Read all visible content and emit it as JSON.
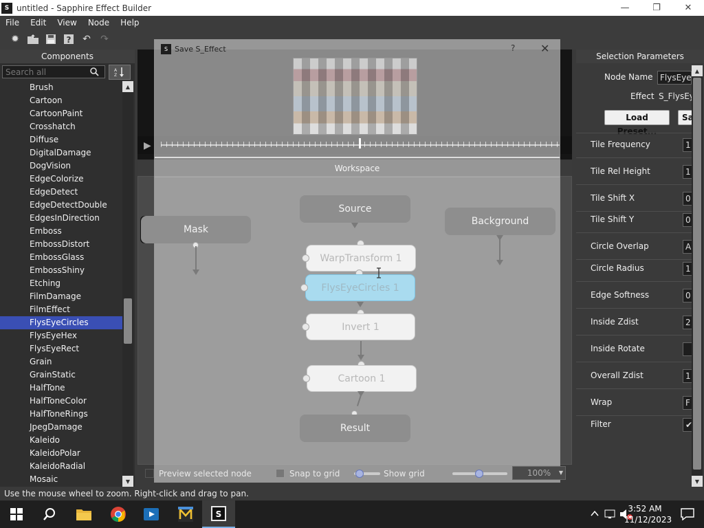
{
  "window": {
    "title": "untitled - Sapphire Effect Builder",
    "app_icon": "S",
    "minimize_icon": "—",
    "maximize_icon": "❐",
    "close_icon": "✕"
  },
  "menu": [
    "File",
    "Edit",
    "View",
    "Node",
    "Help"
  ],
  "left_panel": {
    "header": "Components",
    "search_placeholder": "Search all",
    "selected": "FlysEyeCircles",
    "items": [
      "Brush",
      "Cartoon",
      "CartoonPaint",
      "Crosshatch",
      "Diffuse",
      "DigitalDamage",
      "DogVision",
      "EdgeColorize",
      "EdgeDetect",
      "EdgeDetectDouble",
      "EdgesInDirection",
      "Emboss",
      "EmbossDistort",
      "EmbossGlass",
      "EmbossShiny",
      "Etching",
      "FilmDamage",
      "FilmEffect",
      "FlysEyeCircles",
      "FlysEyeHex",
      "FlysEyeRect",
      "Grain",
      "GrainStatic",
      "HalfTone",
      "HalfToneColor",
      "HalfToneRings",
      "JpegDamage",
      "Kaleido",
      "KaleidoPolar",
      "KaleidoRadial",
      "Mosaic"
    ]
  },
  "right_panel": {
    "header": "Selection Parameters",
    "node_name_label": "Node Name",
    "node_name_value": "FlysEyeC",
    "effect_label": "Effect",
    "effect_value": "S_FlysEye",
    "load_preset_label": "Load Preset...",
    "save_label": "Sa",
    "params": [
      {
        "label": "Tile Frequency",
        "value": "1"
      },
      {
        "label": "Tile Rel Height",
        "value": "1"
      },
      {
        "label": "Tile Shift X",
        "value": "0"
      },
      {
        "label": "Tile Shift Y",
        "value": "0"
      },
      {
        "label": "Circle Overlap",
        "value": "A"
      },
      {
        "label": "Circle Radius",
        "value": "1"
      },
      {
        "label": "Edge Softness",
        "value": "0"
      },
      {
        "label": "Inside Zdist",
        "value": "2"
      },
      {
        "label": "Inside Rotate",
        "value": ""
      },
      {
        "label": "Overall Zdist",
        "value": "1"
      },
      {
        "label": "Wrap",
        "value": "F"
      },
      {
        "label": "Filter",
        "value": "✔"
      }
    ]
  },
  "dialog": {
    "title": "Save S_Effect",
    "help_icon": "?",
    "close_icon": "✕",
    "workspace_label": "Workspace",
    "nodes": {
      "source": "Source",
      "mask": "Mask",
      "background": "Background",
      "warp": "WarpTransform 1",
      "flys": "FlysEyeCircles 1",
      "invert": "Invert 1",
      "cartoon": "Cartoon 1",
      "result": "Result"
    },
    "preview_selected_label": "Preview selected node",
    "snap_label": "Snap to grid",
    "show_grid_label": "Show grid",
    "zoom_value": "100%"
  },
  "status_text": "Use the mouse wheel to zoom.  Right-click and drag to pan.",
  "taskbar": {
    "time": "3:52 AM",
    "date": "11/12/2023"
  }
}
